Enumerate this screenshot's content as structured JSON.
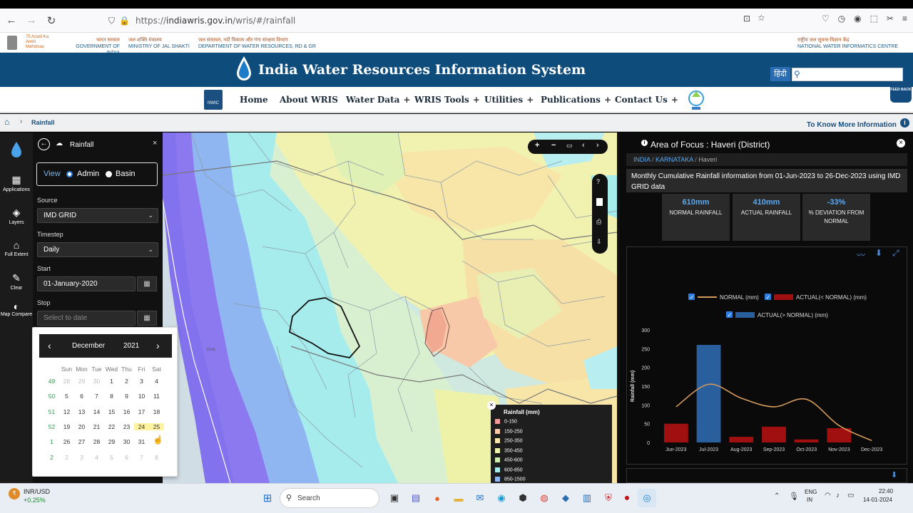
{
  "browser": {
    "url_prefix": "https://",
    "url_host": "indiawris.gov.in",
    "url_path": "/wris/#/rainfall"
  },
  "gov_header": {
    "col1_hindi": "भारत सरकार",
    "col1": "GOVERNMENT OF INDIA",
    "col2_hindi": "जल शक्ति मंत्रालय",
    "col2": "MINISTRY OF JAL SHAKTI",
    "col3_hindi": "जल संसाधन, नदी विकास और गंगा संरक्षण विभाग",
    "col3": "DEPARTMENT OF WATER RESOURCES, RD & GR",
    "right_hindi": "राष्ट्रीय जल सूचना-विज्ञान केंद्र",
    "right": "NATIONAL WATER INFORMATICS CENTRE",
    "azadi": "75 Azadi Ka Amrit Mahotsav"
  },
  "banner": {
    "title": "India Water Resources Information System",
    "hindi_btn": "हिंदी"
  },
  "menu": {
    "logo": "NWIC",
    "items": [
      {
        "label": "Home"
      },
      {
        "label": "About WRIS"
      },
      {
        "label": "Water Data",
        "plus": "+"
      },
      {
        "label": "WRIS Tools",
        "plus": "+"
      },
      {
        "label": "Utilities",
        "plus": "+"
      },
      {
        "label": "Publications",
        "plus": "+"
      },
      {
        "label": "Contact Us",
        "plus": "+"
      }
    ],
    "feedback": "FEED BACK"
  },
  "breadcrumb": {
    "current": "Rainfall",
    "more_info": "To Know More Information"
  },
  "rail": {
    "applications": "Applications",
    "layers": "Layers",
    "full_extent": "Full Extent",
    "clear": "Clear",
    "map_compare": "Map Compare"
  },
  "panel": {
    "title": "Rainfall",
    "view_label": "View",
    "admin": "Admin",
    "basin": "Basin",
    "source_label": "Source",
    "source_value": "IMD GRID",
    "timestep_label": "Timestep",
    "timestep_value": "Daily",
    "start_label": "Start",
    "start_value": "01-January-2020",
    "stop_label": "Stop",
    "stop_placeholder": "Select to date"
  },
  "calendar": {
    "month": "December",
    "year": "2021",
    "weekdays": [
      "Sun",
      "Mon",
      "Tue",
      "Wed",
      "Thu",
      "Fri",
      "Sat"
    ],
    "rows": [
      {
        "wk": "49",
        "days": [
          "28",
          "29",
          "30",
          "1",
          "2",
          "3",
          "4"
        ]
      },
      {
        "wk": "50",
        "days": [
          "5",
          "6",
          "7",
          "8",
          "9",
          "10",
          "11"
        ]
      },
      {
        "wk": "51",
        "days": [
          "12",
          "13",
          "14",
          "15",
          "16",
          "17",
          "18"
        ]
      },
      {
        "wk": "52",
        "days": [
          "19",
          "20",
          "21",
          "22",
          "23",
          "24",
          "25"
        ]
      },
      {
        "wk": "1",
        "days": [
          "26",
          "27",
          "28",
          "29",
          "30",
          "31",
          "1"
        ]
      },
      {
        "wk": "2",
        "days": [
          "2",
          "3",
          "4",
          "5",
          "6",
          "7",
          "8"
        ]
      }
    ]
  },
  "map": {
    "place_label": "Goa",
    "legend_title": "Rainfall (mm)",
    "legend": [
      {
        "label": "0-150",
        "color": "#f29b9b"
      },
      {
        "label": "150-250",
        "color": "#f7c9a8"
      },
      {
        "label": "250-350",
        "color": "#f7e6a8"
      },
      {
        "label": "350-450",
        "color": "#eef2a8"
      },
      {
        "label": "450-600",
        "color": "#cfeeb0"
      },
      {
        "label": "600-850",
        "color": "#a6ecec"
      },
      {
        "label": "850-1500",
        "color": "#8fb6f0"
      }
    ],
    "zoom_in": "+",
    "zoom_out": "−"
  },
  "right_panel": {
    "title": "Area of Focus : Haveri (District)",
    "crumb_india": "INDIA",
    "crumb_state": "KARNATAKA",
    "crumb_district": "Haveri",
    "description": "Monthly Cumulative Rainfall information from 01-Jun-2023 to 26-Dec-2023 using IMD GRID data",
    "stats": [
      {
        "value": "610mm",
        "label": "NORMAL RAINFALL"
      },
      {
        "value": "410mm",
        "label": "ACTUAL RAINFALL"
      },
      {
        "value": "-33%",
        "label": "% DEVIATION FROM NORMAL"
      }
    ]
  },
  "chart_data": {
    "type": "bar",
    "categories": [
      "Jun-2023",
      "Jul-2023",
      "Aug-2023",
      "Sep-2023",
      "Oct-2023",
      "Nov-2023",
      "Dec-2023"
    ],
    "series": [
      {
        "name": "NORMAL (mm)",
        "kind": "line",
        "color": "#d49a5c",
        "values": [
          95,
          155,
          118,
          95,
          115,
          45,
          5
        ]
      },
      {
        "name": "ACTUAL(< NORMAL) (mm)",
        "kind": "bar",
        "color": "#a01010",
        "values": [
          50,
          null,
          15,
          42,
          8,
          38,
          0
        ]
      },
      {
        "name": "ACTUAL(> NORMAL) (mm)",
        "kind": "bar",
        "color": "#2a5f9e",
        "values": [
          null,
          260,
          null,
          null,
          null,
          null,
          null
        ]
      }
    ],
    "ylabel": "Rainfall (mm)",
    "ylim": [
      0,
      300
    ],
    "yticks": [
      "0",
      "50",
      "100",
      "150",
      "200",
      "250",
      "300"
    ]
  },
  "taskbar": {
    "ticker_name": "INR/USD",
    "ticker_value": "+0.25%",
    "search": "Search",
    "lang1": "ENG",
    "lang2": "IN",
    "time": "22:40",
    "date": "14-01-2024"
  }
}
